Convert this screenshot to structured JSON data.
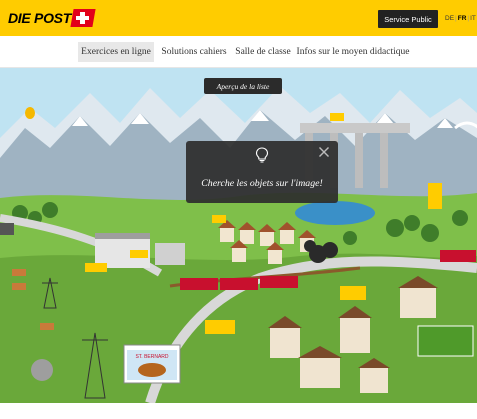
{
  "header": {
    "logo_text": "DIE POST",
    "service_label": "Service Public",
    "languages": [
      "DE",
      "FR",
      "IT"
    ],
    "active_language": "FR"
  },
  "nav": {
    "items": [
      {
        "label": "Exercices en ligne"
      },
      {
        "label": "Solutions cahiers"
      },
      {
        "label": "Salle de classe"
      },
      {
        "label": "Infos sur le moyen didactique"
      }
    ],
    "active_index": 0
  },
  "scene": {
    "preview_button": "Aperçu de la liste",
    "modal": {
      "icon": "lightbulb-icon",
      "close_icon": "close-icon",
      "text": "Cherche les objets sur l'image!"
    },
    "billboard_text": "ST. BERNARD"
  },
  "colors": {
    "brand_yellow": "#ffcc00",
    "brand_red": "#e2001a",
    "sky": "#bfe3f2",
    "grass": "#7fbf4a"
  }
}
